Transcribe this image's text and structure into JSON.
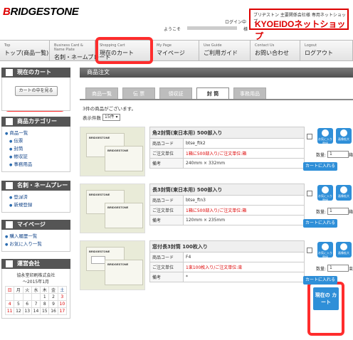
{
  "brand": {
    "logo": "BRIDGESTONE",
    "shop_sub": "ブリヂストン 主要関係会社様 専用ネットショップ",
    "shop_name": "KYOEIDOネットショップ"
  },
  "login": {
    "welcome": "ようこそ",
    "suffix": "様",
    "logout": "ログイン中"
  },
  "nav": [
    {
      "en": "Top",
      "jp": "トップ(商品一覧)"
    },
    {
      "en": "Business Card & Name Plate",
      "jp": "名刺・ネームプレート"
    },
    {
      "en": "Shopping Cart",
      "jp": "現在のカート"
    },
    {
      "en": "My Page",
      "jp": "マイページ"
    },
    {
      "en": "Use Guide",
      "jp": "ご利用ガイド"
    },
    {
      "en": "Contact Us",
      "jp": "お問い合わせ"
    },
    {
      "en": "Logout",
      "jp": "ログアウト"
    }
  ],
  "sidebar": {
    "cart_title": "現在のカート",
    "cart_button": "カートの中を見る",
    "category_title": "商品カテゴリー",
    "categories": [
      {
        "label": "商品一覧",
        "sub": false
      },
      {
        "label": "伝票",
        "sub": true
      },
      {
        "label": "封筒",
        "sub": true
      },
      {
        "label": "帳収証",
        "sub": true
      },
      {
        "label": "事務用品",
        "sub": true
      }
    ],
    "namecard_title": "名刺・ネームプレート",
    "namecard_links": [
      "登録済",
      "新規登録"
    ],
    "mypage_title": "マイページ",
    "mypage_links": [
      "購入履歴一覧",
      "お気に入り一覧"
    ],
    "company_title": "運営会社",
    "company_name": "協永堂印刷株式会社",
    "calendar_month": "～2015年1月",
    "calendar_days": [
      "日",
      "月",
      "火",
      "水",
      "木",
      "金",
      "土"
    ],
    "calendar_rows": [
      [
        "",
        "",
        "",
        "",
        "1",
        "2",
        "3"
      ],
      [
        "4",
        "5",
        "6",
        "7",
        "8",
        "9",
        "10"
      ],
      [
        "11",
        "12",
        "13",
        "14",
        "15",
        "16",
        "17"
      ]
    ]
  },
  "main": {
    "title": "商品注文",
    "tabs": [
      "商品一覧",
      "伝 票",
      "領収証",
      "封 筒",
      "事務用品"
    ],
    "active_tab": 3,
    "info": "3件の商品がございます。",
    "display_label": "表示件数",
    "display_value": "15件",
    "products": [
      {
        "name": "角2封筒(東日本用) 500部入り",
        "code_label": "商品コード",
        "code": "btse_ftk2",
        "unit_label": "ご注文単位",
        "unit": "1箱に500部入り/ご注文単位:箱",
        "note_label": "備考",
        "note": "240mm × 332mm",
        "qty_label": "数量:",
        "qty": "1",
        "qty_unit": "箱",
        "add": "カートに入れる"
      },
      {
        "name": "長3封筒(東日本用) 500部入り",
        "code_label": "商品コード",
        "code": "btse_ftn3",
        "unit_label": "ご注文単位",
        "unit": "1箱に500部入り/ご注文単位:箱",
        "note_label": "備考",
        "note": "120mm × 235mm",
        "qty_label": "数量:",
        "qty": "1",
        "qty_unit": "箱",
        "add": "カートに入れる"
      },
      {
        "name": "窓付長3封筒 100枚入り",
        "code_label": "商品コード",
        "code": "F4",
        "unit_label": "ご注文単位",
        "unit": "1束100枚入り/ご注文単位:束",
        "note_label": "備考",
        "note": "*",
        "qty_label": "数量:",
        "qty": "1",
        "qty_unit": "束",
        "add": "カートに入れる"
      }
    ],
    "fav_label": "お気に入り登録",
    "zoom_label": "画像拡大",
    "float_cart": "現在の カート"
  },
  "colors": {
    "accent": "#2f8fd8",
    "highlight": "#ff2d2d",
    "brand_red": "#d00000"
  }
}
